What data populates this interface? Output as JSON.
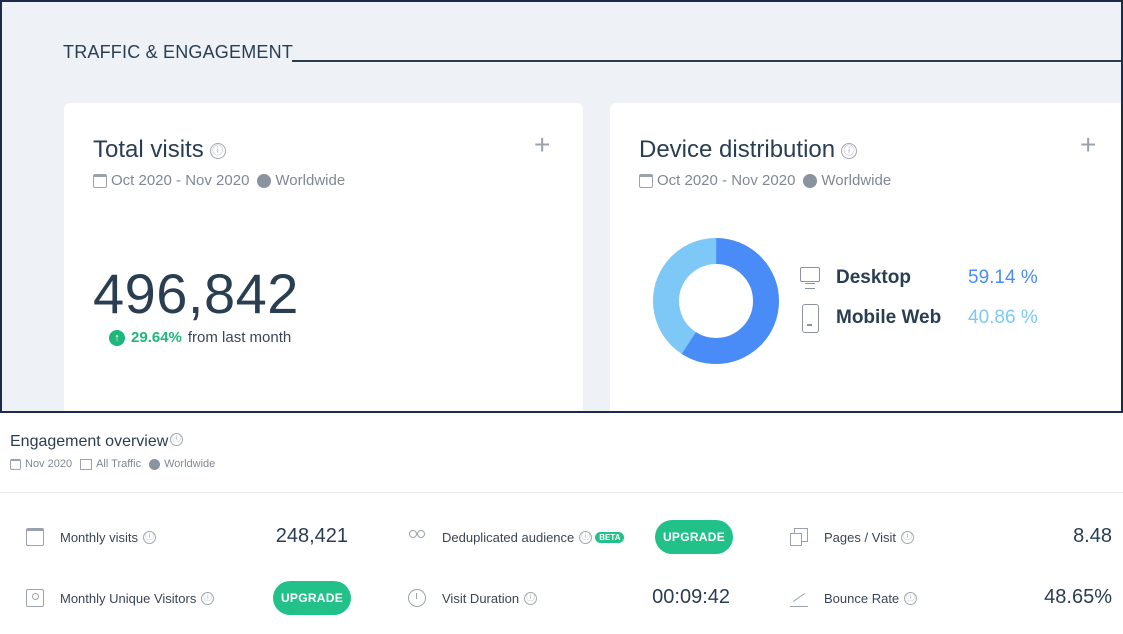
{
  "section": {
    "title": "TRAFFIC & ENGAGEMENT"
  },
  "total_visits": {
    "title": "Total visits",
    "info_icon": "ⓘ",
    "add_icon": "+",
    "date_range": "Oct 2020 - Nov 2020",
    "region": "Worldwide",
    "value": "496,842",
    "growth_value": "29.64%",
    "growth_label": "from last month",
    "growth_color": "#1db77a"
  },
  "device_distribution": {
    "title": "Device distribution",
    "info_icon": "ⓘ",
    "add_icon": "+",
    "date_range": "Oct 2020 - Nov 2020",
    "region": "Worldwide",
    "devices": [
      {
        "label": "Desktop",
        "value": "59.14 %",
        "share": 59.14,
        "color": "#4a8cf7",
        "icon": "desktop-icon"
      },
      {
        "label": "Mobile Web",
        "value": "40.86 %",
        "share": 40.86,
        "color": "#7ec8f8",
        "icon": "mobile-icon"
      }
    ]
  },
  "engagement": {
    "title": "Engagement overview",
    "info_icon": "ⓘ",
    "date": "Nov 2020",
    "traffic": "All Traffic",
    "region": "Worldwide",
    "upgrade_label": "UPGRADE",
    "beta_label": "BETA",
    "metrics": {
      "monthly_visits": {
        "label": "Monthly visits",
        "value": "248,421"
      },
      "dedup_audience": {
        "label": "Deduplicated audience"
      },
      "pages_visit": {
        "label": "Pages / Visit",
        "value": "8.48"
      },
      "unique_visitors": {
        "label": "Monthly Unique Visitors"
      },
      "visit_duration": {
        "label": "Visit Duration",
        "value": "00:09:42"
      },
      "bounce_rate": {
        "label": "Bounce Rate",
        "value": "48.65%"
      }
    }
  },
  "colors": {
    "accent_green": "#22c18a",
    "desktop_blue": "#4a8cf7",
    "mobile_blue": "#7ec8f8",
    "text_dark": "#2a3e52"
  }
}
